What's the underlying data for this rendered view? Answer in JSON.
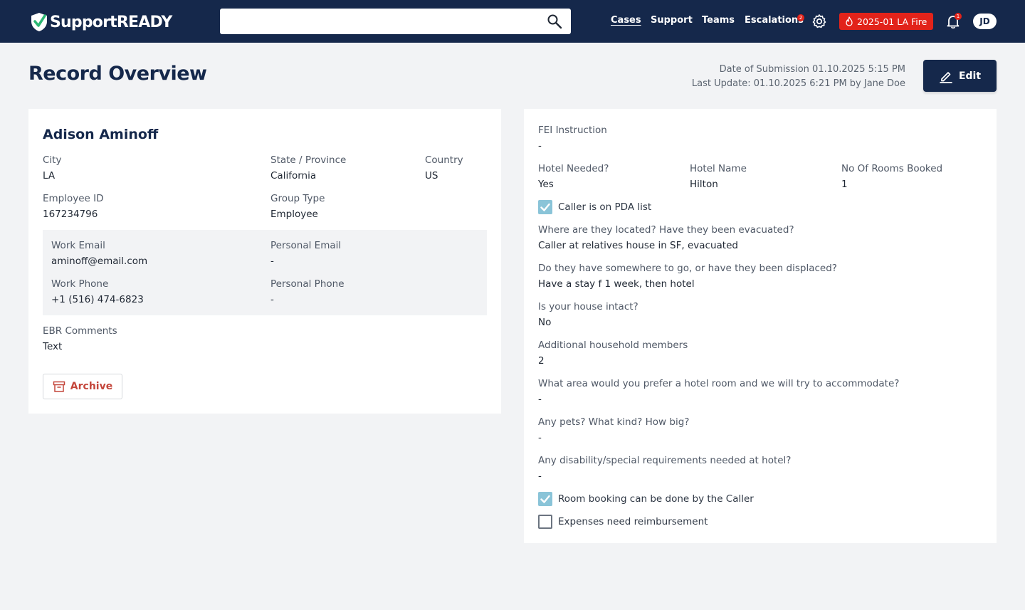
{
  "header": {
    "logo_text": "SupportREADY",
    "search": {
      "value": "",
      "placeholder": ""
    },
    "nav": [
      "Cases",
      "Support",
      "Teams",
      "Escalations"
    ],
    "escalations_badge": "2",
    "incident_label": "2025-01 LA Fire",
    "notifications_badge": "1",
    "user_initials": "JD",
    "colors": {
      "header_bg": "#15284b",
      "incident_bg": "#e2231a",
      "check_on": "#8ac4d8"
    }
  },
  "page": {
    "title": "Record Overview",
    "submission": "Date of Submission 01.10.2025 5:15 PM",
    "last_update": "Last Update: 01.10.2025 6:21 PM by Jane Doe",
    "edit_label": "Edit"
  },
  "person": {
    "name": "Adison Aminoff",
    "city_label": "City",
    "city": "LA",
    "state_label": "State / Province",
    "state": "California",
    "country_label": "Country",
    "country": "US",
    "employee_id_label": "Employee ID",
    "employee_id": "167234796",
    "group_type_label": "Group Type",
    "group_type": "Employee",
    "work_email_label": "Work Email",
    "work_email": "aminoff@email.com",
    "personal_email_label": "Personal Email",
    "personal_email": "-",
    "work_phone_label": "Work Phone",
    "work_phone": "+1 (516) 474-6823",
    "personal_phone_label": "Personal Phone",
    "personal_phone": "-",
    "ebr_comments_label": "EBR Comments",
    "ebr_comments": "Text",
    "archive_label": "Archive"
  },
  "details": {
    "fei_label": "FEI Instruction",
    "fei": "-",
    "hotel_needed_label": "Hotel Needed?",
    "hotel_needed": "Yes",
    "hotel_name_label": "Hotel Name",
    "hotel_name": "Hilton",
    "rooms_label": "No Of Rooms Booked",
    "rooms": "1",
    "pda_label": "Caller is on PDA list",
    "pda_checked": true,
    "questions": [
      {
        "q": "Where are they located? Have they been evacuated?",
        "a": "Caller at relatives house in SF, evacuated"
      },
      {
        "q": "Do they have somewhere to go, or have they been displaced?",
        "a": "Have a stay f 1 week, then hotel"
      },
      {
        "q": "Is your house intact?",
        "a": "No"
      },
      {
        "q": "Additional household members",
        "a": "2"
      },
      {
        "q": "What area would you prefer a hotel room and we will try to accommodate?",
        "a": "-"
      },
      {
        "q": "Any pets? What kind? How big?",
        "a": "-"
      },
      {
        "q": "Any disability/special requirements needed at hotel?",
        "a": "-"
      }
    ],
    "room_booking_label": "Room booking can be done by the Caller",
    "room_booking_checked": true,
    "expenses_label": "Expenses need reimbursement",
    "expenses_checked": false
  }
}
